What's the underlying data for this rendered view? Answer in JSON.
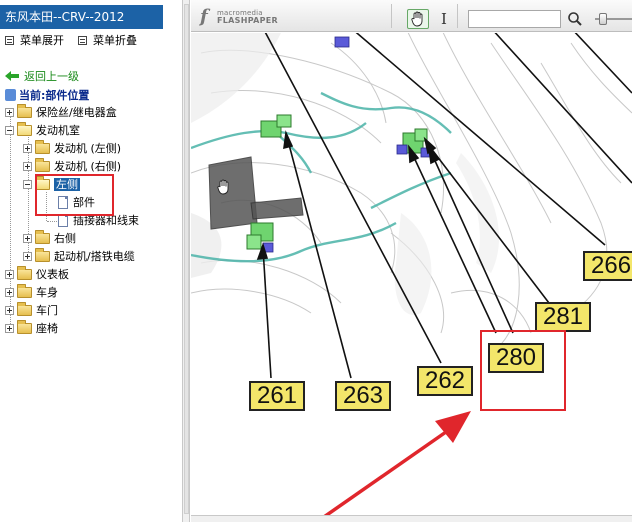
{
  "sidebar": {
    "title": "东风本田--CRV--2012",
    "expand_label": "菜单展开",
    "collapse_label": "菜单折叠",
    "back_label": "返回上一级",
    "current_label": "当前:部件位置",
    "tree": {
      "fuse_relay": "保险丝/继电器盒",
      "engine_room": "发动机室",
      "engine_left": "发动机 (左侧)",
      "engine_right": "发动机 (右侧)",
      "left_side": "左侧",
      "parts": "部件",
      "connectors": "插接器和线束",
      "right_side": "右侧",
      "starter_cable": "起动机/搭铁电缆",
      "dashboard": "仪表板",
      "body": "车身",
      "door": "车门",
      "seat": "座椅"
    }
  },
  "viewer": {
    "logo_top": "macromedia",
    "logo_bottom": "FLASHPAPER",
    "search": {
      "value": "",
      "placeholder": ""
    },
    "icons": {
      "hand": "hand-icon",
      "text_select": "text-cursor-icon",
      "search": "magnifier-icon"
    },
    "callouts": {
      "c261": "261",
      "c263": "263",
      "c262": "262",
      "c280": "280",
      "c281": "281",
      "c266": "266"
    }
  },
  "colors": {
    "title_bar": "#1c62a6",
    "highlight": "#e0262c",
    "callout_fill": "#f3e66a",
    "back_link": "#1a8a1a"
  }
}
